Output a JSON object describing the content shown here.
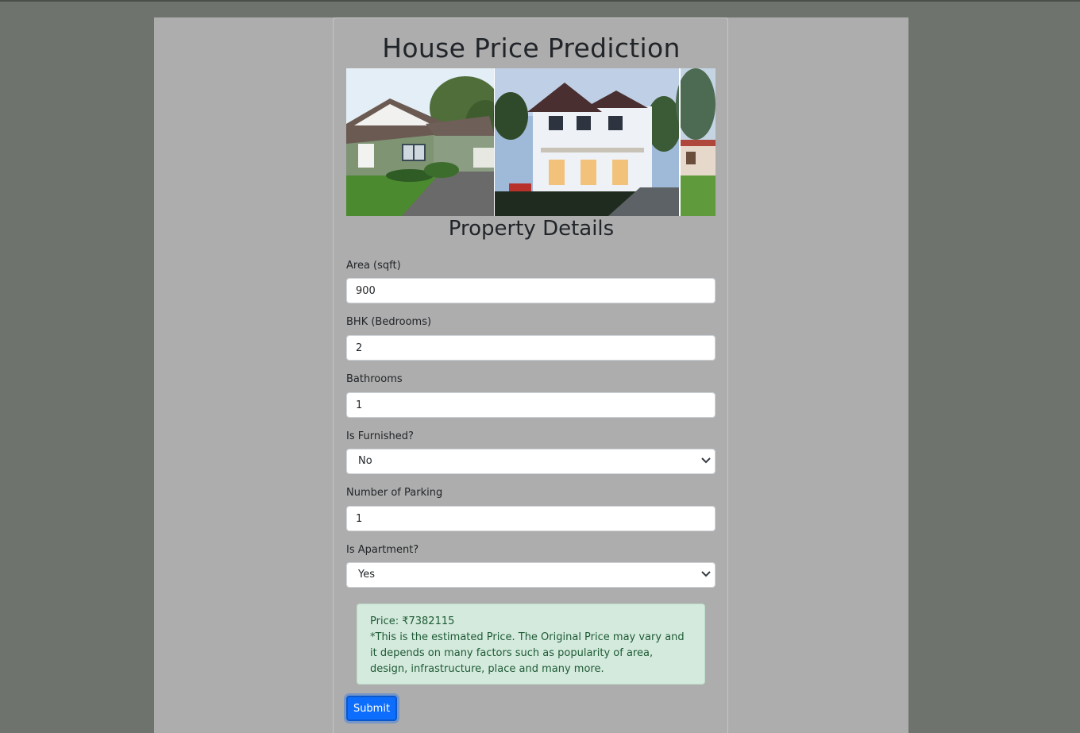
{
  "header": {
    "title": "House Price Prediction"
  },
  "banner": {
    "icon": "house-photos-image"
  },
  "form": {
    "section_title": "Property Details",
    "area": {
      "label": "Area (sqft)",
      "value": "900"
    },
    "bhk": {
      "label": "BHK (Bedrooms)",
      "value": "2"
    },
    "bathrooms": {
      "label": "Bathrooms",
      "value": "1"
    },
    "furnished": {
      "label": "Is Furnished?",
      "selected": "No"
    },
    "parking": {
      "label": "Number of Parking",
      "value": "1"
    },
    "apartment": {
      "label": "Is Apartment?",
      "selected": "Yes"
    }
  },
  "result": {
    "price_line": "Price: ₹7382115",
    "note": "*This is the estimated Price. The Original Price may vary and it depends on many factors such as popularity of area, design, infrastructure, place and many more."
  },
  "actions": {
    "submit_label": "Submit"
  },
  "colors": {
    "page_bg": "#6f736d",
    "panel_bg": "#adadad",
    "primary": "#0d6efd",
    "alert_bg": "#d4eadd"
  }
}
